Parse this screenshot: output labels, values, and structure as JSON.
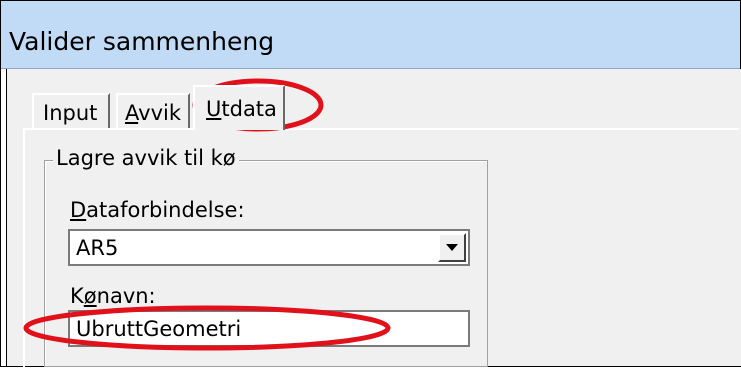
{
  "window": {
    "title": "Valider sammenheng"
  },
  "tabs": [
    {
      "label": "Input",
      "selected": false
    },
    {
      "label": "Avvik",
      "mnemonic": "A",
      "rest": "vvik",
      "selected": false
    },
    {
      "label": "Utdata",
      "mnemonic": "U",
      "rest": "tdata",
      "selected": true
    }
  ],
  "group": {
    "legend": "Lagre avvik til kø",
    "dataforbindelse": {
      "label": "Dataforbindelse:",
      "mnemonic": "D",
      "rest": "ataforbindelse:",
      "value": "AR5"
    },
    "konavn": {
      "label": "Kønavn:",
      "pre": "K",
      "mnemonic": "ø",
      "rest": "navn:",
      "value": "UbruttGeometri"
    }
  },
  "annotation_color": "#e0111b",
  "icons": {
    "combo_dropdown": "chevron-down-icon"
  }
}
